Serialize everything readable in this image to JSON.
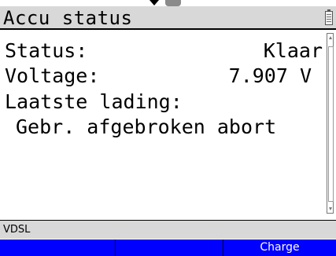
{
  "window": {
    "title": "Accu status"
  },
  "fields": {
    "status_label": "Status:",
    "status_value": "Klaar",
    "voltage_label": "Voltage:",
    "voltage_value": "7.907 V",
    "last_charge_label": "Laatste lading:",
    "last_charge_value": "Gebr. afgebroken abort"
  },
  "statusbar": {
    "text": "VDSL"
  },
  "softkeys": [
    "",
    "",
    "Charge"
  ],
  "colors": {
    "softkey_bar": "#0000ff",
    "titlebar": "#d8d8d8",
    "statusbar": "#d8d8d8"
  }
}
